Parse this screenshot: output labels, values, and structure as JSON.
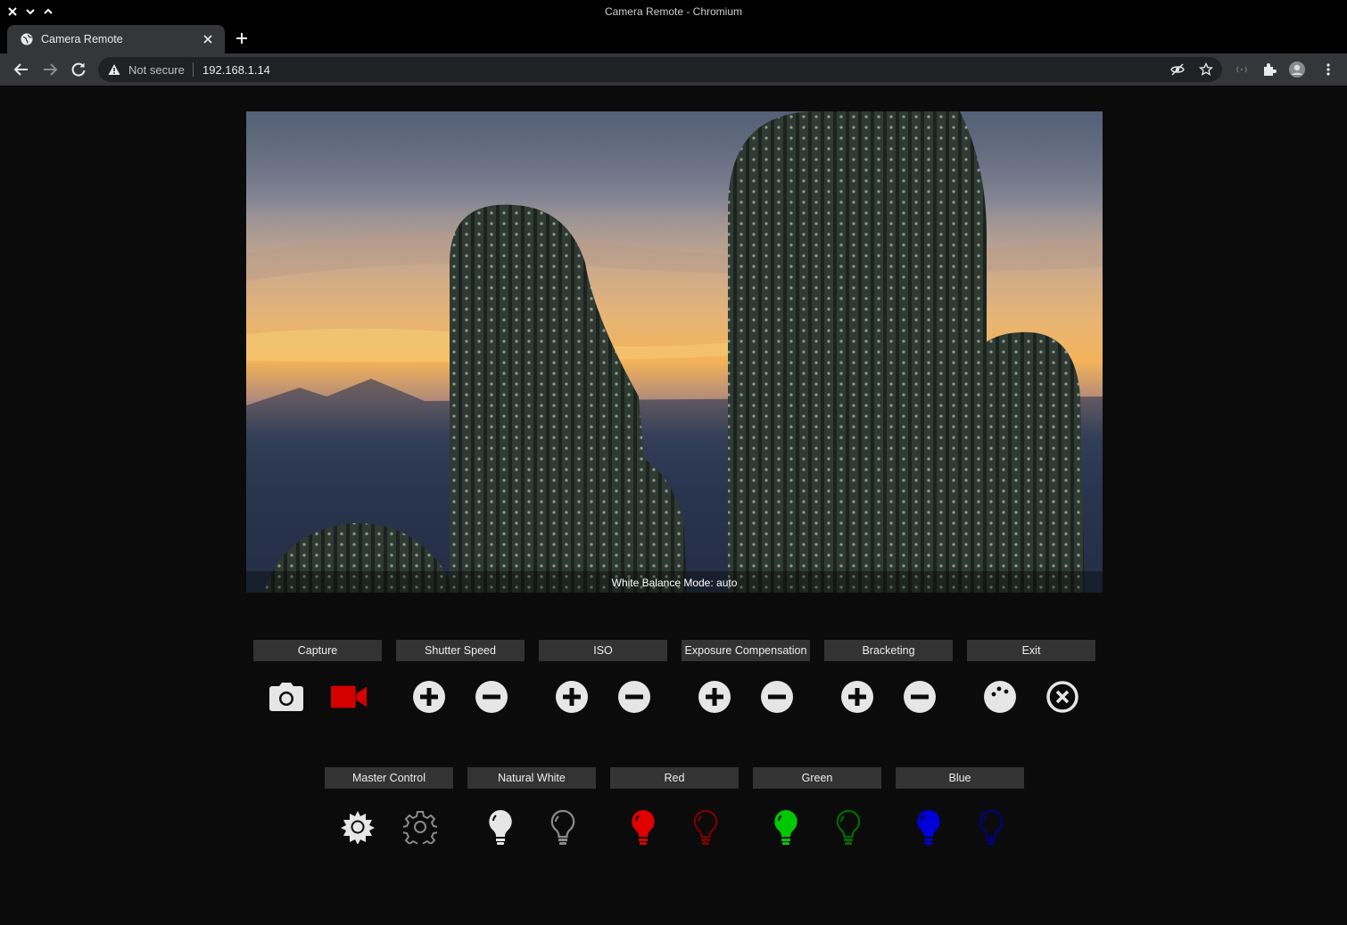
{
  "window": {
    "title": "Camera Remote - Chromium"
  },
  "tab": {
    "title": "Camera Remote"
  },
  "address_bar": {
    "security_label": "Not secure",
    "url": "192.168.1.14"
  },
  "viewer": {
    "caption": "White Balance Mode: auto"
  },
  "controls_row1": [
    {
      "label": "Capture"
    },
    {
      "label": "Shutter Speed"
    },
    {
      "label": "ISO"
    },
    {
      "label": "Exposure Compensation"
    },
    {
      "label": "Bracketing"
    },
    {
      "label": "Exit"
    }
  ],
  "controls_row2": [
    {
      "label": "Master Control"
    },
    {
      "label": "Natural White"
    },
    {
      "label": "Red"
    },
    {
      "label": "Green"
    },
    {
      "label": "Blue"
    }
  ],
  "colors": {
    "page_bg": "#0b0b0b",
    "label_bg": "#333333",
    "icon_white": "#e6e6e6",
    "icon_dim": "#8a8a8a",
    "record_red": "#d40000",
    "red_on": "#e00000",
    "red_off": "#7a0000",
    "green_on": "#00c800",
    "green_off": "#006b00",
    "blue_on": "#0000d8",
    "blue_off": "#000080"
  },
  "icons": {
    "capture": [
      "camera-icon",
      "video-camera-icon"
    ],
    "adjust": [
      "plus-circle-icon",
      "minus-circle-icon"
    ],
    "exit": [
      "palette-icon",
      "close-circle-icon"
    ],
    "master": [
      "sun-icon",
      "gear-icon"
    ],
    "light": [
      "lightbulb-on-icon",
      "lightbulb-off-icon"
    ]
  }
}
